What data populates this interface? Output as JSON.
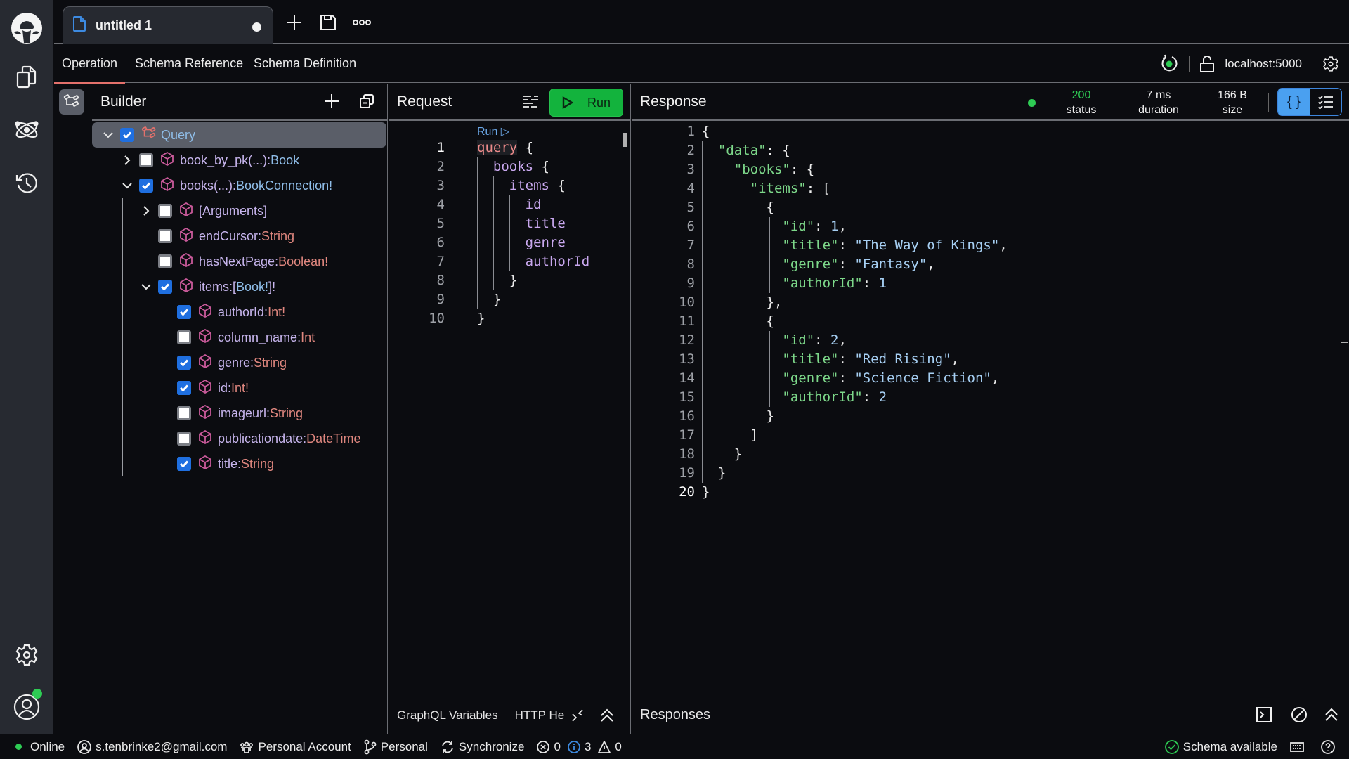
{
  "top": {
    "doc_tab": {
      "title": "untitled 1",
      "unsaved": true
    },
    "new_tab_icon": "plus-icon",
    "save_icon": "floppy-icon",
    "more_icon": "ellipsis-icon"
  },
  "rail": {
    "logo": "app-logo",
    "items": [
      "documents-icon",
      "atom-icon",
      "history-icon"
    ],
    "bottom": [
      "settings-icon",
      "account-icon"
    ]
  },
  "subnav": {
    "tabs": [
      {
        "label": "Operation",
        "active": true
      },
      {
        "label": "Schema Reference",
        "active": false
      },
      {
        "label": "Schema Definition",
        "active": false
      }
    ],
    "endpoint": "localhost:5000"
  },
  "builder": {
    "title": "Builder",
    "tree": [
      {
        "name": "Query",
        "type": "",
        "checked": true,
        "expanded": true,
        "depth": 0,
        "root": true
      },
      {
        "name": "book_by_pk(...)",
        "type": "Book",
        "type_kind": "obj",
        "checked": false,
        "expanded": false,
        "depth": 1,
        "has_children": true
      },
      {
        "name": "books(...)",
        "type": "BookConnection!",
        "type_kind": "obj",
        "checked": true,
        "expanded": true,
        "depth": 1,
        "has_children": true
      },
      {
        "name": "[Arguments]",
        "type": "",
        "checked": false,
        "expanded": false,
        "depth": 2,
        "has_children": true
      },
      {
        "name": "endCursor",
        "type": "String",
        "checked": false,
        "depth": 2
      },
      {
        "name": "hasNextPage",
        "type": "Boolean!",
        "checked": false,
        "depth": 2
      },
      {
        "name": "items",
        "type": "[Book!]!",
        "type_kind": "list",
        "checked": true,
        "expanded": true,
        "depth": 2,
        "has_children": true
      },
      {
        "name": "authorId",
        "type": "Int!",
        "checked": true,
        "depth": 3
      },
      {
        "name": "column_name",
        "type": "Int",
        "checked": false,
        "depth": 3
      },
      {
        "name": "genre",
        "type": "String",
        "checked": true,
        "depth": 3
      },
      {
        "name": "id",
        "type": "Int!",
        "checked": true,
        "depth": 3
      },
      {
        "name": "imageurl",
        "type": "String",
        "checked": false,
        "depth": 3
      },
      {
        "name": "publicationdate",
        "type": "DateTime",
        "checked": false,
        "depth": 3
      },
      {
        "name": "title",
        "type": "String",
        "checked": true,
        "depth": 3
      }
    ]
  },
  "request": {
    "title": "Request",
    "run_label": "Run",
    "codelens": "Run ▷",
    "lines": [
      [
        [
          "kw",
          "query"
        ],
        [
          "pn",
          " {"
        ]
      ],
      [
        [
          "pn",
          "  "
        ],
        [
          "fld",
          "books"
        ],
        [
          "pn",
          " {"
        ]
      ],
      [
        [
          "pn",
          "    "
        ],
        [
          "fld",
          "items"
        ],
        [
          "pn",
          " {"
        ]
      ],
      [
        [
          "pn",
          "      "
        ],
        [
          "fld",
          "id"
        ]
      ],
      [
        [
          "pn",
          "      "
        ],
        [
          "fld",
          "title"
        ]
      ],
      [
        [
          "pn",
          "      "
        ],
        [
          "fld",
          "genre"
        ]
      ],
      [
        [
          "pn",
          "      "
        ],
        [
          "fld",
          "authorId"
        ]
      ],
      [
        [
          "pn",
          "    }"
        ]
      ],
      [
        [
          "pn",
          "  }"
        ]
      ],
      [
        [
          "pn",
          "}"
        ]
      ]
    ],
    "current_line": 1,
    "bottom_tabs": [
      "GraphQL Variables",
      "HTTP He"
    ]
  },
  "response": {
    "title": "Response",
    "status": {
      "value": "200",
      "label": "status",
      "color": "#2ecc54"
    },
    "duration": {
      "value": "7 ms",
      "label": "duration"
    },
    "size": {
      "value": "166 B",
      "label": "size"
    },
    "view_modes": [
      "json",
      "list"
    ],
    "active_view": "json",
    "lines": [
      [
        [
          "pn",
          "{"
        ]
      ],
      [
        [
          "pn",
          "  "
        ],
        [
          "jk",
          "\"data\""
        ],
        [
          "pn",
          ": {"
        ]
      ],
      [
        [
          "pn",
          "    "
        ],
        [
          "jk",
          "\"books\""
        ],
        [
          "pn",
          ": {"
        ]
      ],
      [
        [
          "pn",
          "      "
        ],
        [
          "jk",
          "\"items\""
        ],
        [
          "pn",
          ": ["
        ]
      ],
      [
        [
          "pn",
          "        {"
        ]
      ],
      [
        [
          "pn",
          "          "
        ],
        [
          "jk",
          "\"id\""
        ],
        [
          "pn",
          ": "
        ],
        [
          "jn",
          "1"
        ],
        [
          "pn",
          ","
        ]
      ],
      [
        [
          "pn",
          "          "
        ],
        [
          "jk",
          "\"title\""
        ],
        [
          "pn",
          ": "
        ],
        [
          "js",
          "\"The Way of Kings\""
        ],
        [
          "pn",
          ","
        ]
      ],
      [
        [
          "pn",
          "          "
        ],
        [
          "jk",
          "\"genre\""
        ],
        [
          "pn",
          ": "
        ],
        [
          "js",
          "\"Fantasy\""
        ],
        [
          "pn",
          ","
        ]
      ],
      [
        [
          "pn",
          "          "
        ],
        [
          "jk",
          "\"authorId\""
        ],
        [
          "pn",
          ": "
        ],
        [
          "jn",
          "1"
        ]
      ],
      [
        [
          "pn",
          "        },"
        ]
      ],
      [
        [
          "pn",
          "        {"
        ]
      ],
      [
        [
          "pn",
          "          "
        ],
        [
          "jk",
          "\"id\""
        ],
        [
          "pn",
          ": "
        ],
        [
          "jn",
          "2"
        ],
        [
          "pn",
          ","
        ]
      ],
      [
        [
          "pn",
          "          "
        ],
        [
          "jk",
          "\"title\""
        ],
        [
          "pn",
          ": "
        ],
        [
          "js",
          "\"Red Rising\""
        ],
        [
          "pn",
          ","
        ]
      ],
      [
        [
          "pn",
          "          "
        ],
        [
          "jk",
          "\"genre\""
        ],
        [
          "pn",
          ": "
        ],
        [
          "js",
          "\"Science Fiction\""
        ],
        [
          "pn",
          ","
        ]
      ],
      [
        [
          "pn",
          "          "
        ],
        [
          "jk",
          "\"authorId\""
        ],
        [
          "pn",
          ": "
        ],
        [
          "jn",
          "2"
        ]
      ],
      [
        [
          "pn",
          "        }"
        ]
      ],
      [
        [
          "pn",
          "      ]"
        ]
      ],
      [
        [
          "pn",
          "    }"
        ]
      ],
      [
        [
          "pn",
          "  }"
        ]
      ],
      [
        [
          "pn",
          "}"
        ]
      ]
    ],
    "current_line": 20,
    "bottom_title": "Responses"
  },
  "statusbar": {
    "online": "Online",
    "email": "s.tenbrinke2@gmail.com",
    "account": "Personal Account",
    "workspace": "Personal",
    "sync": "Synchronize",
    "errors": "0",
    "infos": "3",
    "warnings": "0",
    "schema": "Schema available"
  },
  "colors": {
    "accent_green": "#13b33d",
    "accent_blue": "#4aa0f0",
    "active_tab_underline": "#e4716c",
    "online_dot": "#2ecc54"
  }
}
